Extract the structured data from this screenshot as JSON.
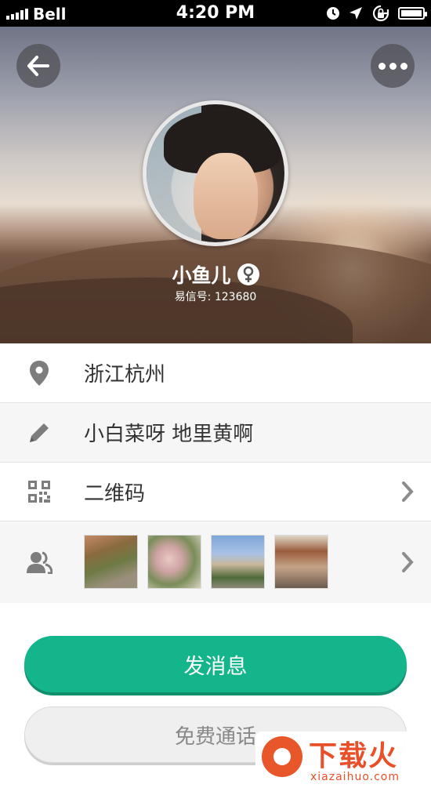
{
  "status_bar": {
    "carrier": "Bell",
    "time": "4:20 PM",
    "icons": [
      "signal-icon",
      "clock-icon",
      "location-arrow-icon",
      "rotation-lock-icon",
      "battery-icon"
    ]
  },
  "header": {
    "back_icon": "arrow-left-icon",
    "more_icon": "more-dots-icon",
    "name": "小鱼儿",
    "gender_icon": "female-icon",
    "id_text": "易信号: 123680"
  },
  "info": {
    "location": "浙江杭州",
    "signature": "小白菜呀 地里黄啊",
    "qr_label": "二维码",
    "photos_icon": "contacts-icon",
    "photo_count": 4
  },
  "actions": {
    "send_message": "发消息",
    "free_call": "免费通话"
  },
  "watermark": {
    "title": "下载火",
    "url": "xiazaihuo.com"
  },
  "colors": {
    "accent": "#15b58c",
    "watermark": "#e8502a"
  }
}
